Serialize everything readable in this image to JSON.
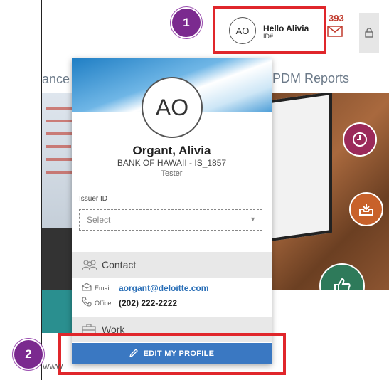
{
  "header": {
    "left_tab": "ance",
    "right_tab": "PDM Reports",
    "greeting": "Hello Alivia",
    "id_label": "ID#",
    "notification_count": "393",
    "avatar_initials": "AO"
  },
  "badges": {
    "one": "1",
    "two": "2"
  },
  "profile": {
    "initials": "AO",
    "name": "Organt, Alivia",
    "organization": "BANK OF HAWAII - IS_1857",
    "role": "Tester",
    "issuer_label": "Issuer ID",
    "issuer_placeholder": "Select",
    "contact_heading": "Contact",
    "email_label": "Email",
    "email_value": "aorgant@deloitte.com",
    "office_label": "Office",
    "office_value": "(202) 222-2222",
    "work_heading": "Work",
    "edit_button": "EDIT MY PROFILE"
  },
  "footer": {
    "text": "WWW"
  },
  "colors": {
    "annotation_red": "#e0262b",
    "badge_purple": "#7b2a8f",
    "button_blue": "#3a78c2",
    "email_blue": "#2a6fb7"
  },
  "icons": [
    "mail-icon",
    "lock-icon",
    "clock-icon",
    "inbox-icon",
    "thumbs-up-icon",
    "contact-icon",
    "email-icon",
    "phone-icon",
    "work-icon",
    "pencil-icon",
    "chevron-down-icon"
  ]
}
